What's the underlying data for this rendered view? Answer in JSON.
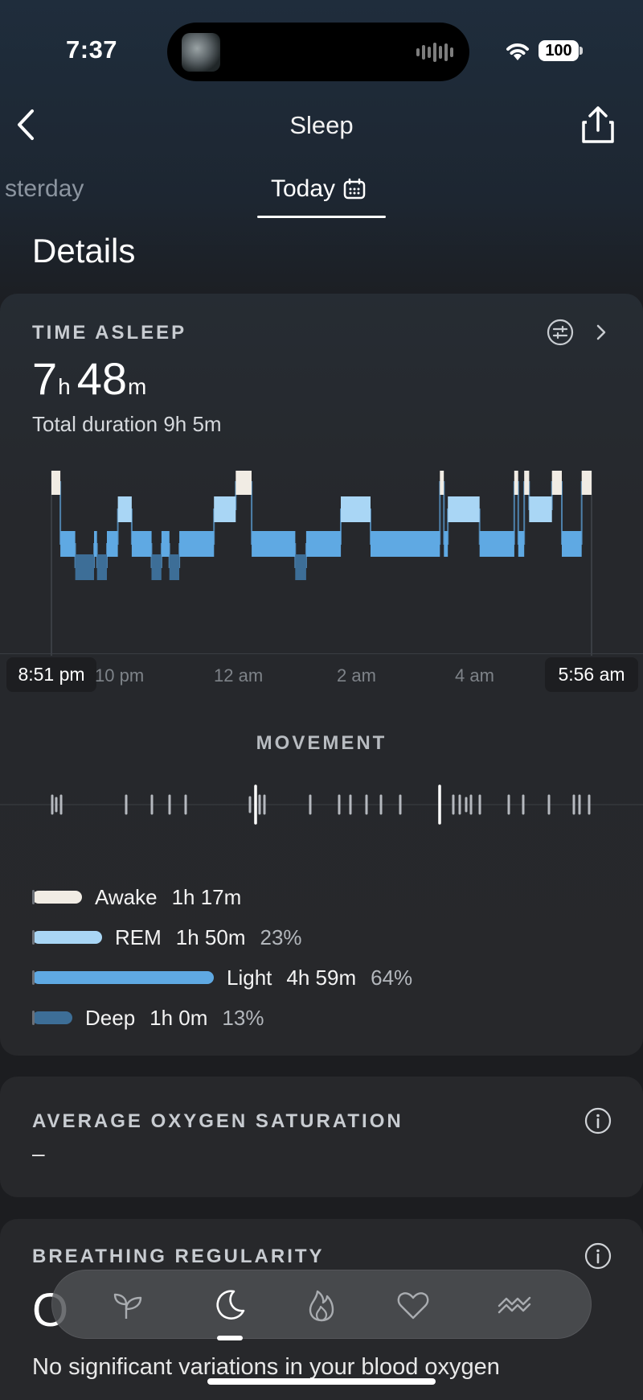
{
  "status_bar": {
    "time": "7:37",
    "battery": "100"
  },
  "header": {
    "title": "Sleep"
  },
  "date_tabs": {
    "previous": "sterday",
    "current": "Today"
  },
  "details": {
    "title": "Details",
    "time_asleep": {
      "label": "TIME ASLEEP",
      "hours": "7",
      "hours_unit": "h",
      "minutes": "48",
      "minutes_unit": "m",
      "total_duration": "Total duration 9h 5m"
    },
    "chart": {
      "start_time": "8:51 pm",
      "end_time": "5:56 am",
      "tick_labels": [
        "10 pm",
        "12 am",
        "2 am",
        "4 am"
      ]
    },
    "movement": {
      "label": "MOVEMENT"
    },
    "legend": [
      {
        "name": "Awake",
        "duration": "1h 17m",
        "percent": "",
        "color": "#f1ece4"
      },
      {
        "name": "REM",
        "duration": "1h 50m",
        "percent": "23%",
        "color": "#a9d6f5"
      },
      {
        "name": "Light",
        "duration": "4h 59m",
        "percent": "64%",
        "color": "#5fa9e3"
      },
      {
        "name": "Deep",
        "duration": "1h 0m",
        "percent": "13%",
        "color": "#3d6e97"
      }
    ]
  },
  "oxygen": {
    "label": "AVERAGE OXYGEN SATURATION",
    "value": "–"
  },
  "breathing": {
    "label": "BREATHING REGULARITY",
    "value": "O",
    "description": "No significant variations in your blood oxygen"
  },
  "tabbar": {
    "items": [
      {
        "icon": "sprout-icon"
      },
      {
        "icon": "moon-icon",
        "active": true
      },
      {
        "icon": "flame-icon"
      },
      {
        "icon": "heart-icon"
      },
      {
        "icon": "waves-icon"
      }
    ]
  },
  "colors": {
    "awake": "#f1ece4",
    "rem": "#a9d6f5",
    "light": "#5fa9e3",
    "deep": "#3d6e97"
  },
  "chart_data": {
    "type": "area",
    "title": "",
    "x_range": [
      "8:51 pm",
      "5:56 am"
    ],
    "x_ticks": [
      "10 pm",
      "12 am",
      "2 am",
      "4 am"
    ],
    "stages": [
      "Awake",
      "REM",
      "Light",
      "Deep"
    ],
    "segments": [
      {
        "stage": "Awake",
        "start": "8:51 pm",
        "end": "9:00 pm"
      },
      {
        "stage": "Light",
        "start": "9:00 pm",
        "end": "9:15 pm"
      },
      {
        "stage": "Deep",
        "start": "9:15 pm",
        "end": "9:34 pm"
      },
      {
        "stage": "Light",
        "start": "9:34 pm",
        "end": "9:37 pm"
      },
      {
        "stage": "Deep",
        "start": "9:37 pm",
        "end": "9:47 pm"
      },
      {
        "stage": "Light",
        "start": "9:47 pm",
        "end": "9:58 pm"
      },
      {
        "stage": "REM",
        "start": "9:58 pm",
        "end": "10:12 pm"
      },
      {
        "stage": "Light",
        "start": "10:12 pm",
        "end": "10:32 pm"
      },
      {
        "stage": "Deep",
        "start": "10:32 pm",
        "end": "10:42 pm"
      },
      {
        "stage": "Light",
        "start": "10:42 pm",
        "end": "10:50 pm"
      },
      {
        "stage": "Deep",
        "start": "10:50 pm",
        "end": "11:00 pm"
      },
      {
        "stage": "Light",
        "start": "11:00 pm",
        "end": "11:35 pm"
      },
      {
        "stage": "REM",
        "start": "11:35 pm",
        "end": "11:57 pm"
      },
      {
        "stage": "Awake",
        "start": "11:57 pm",
        "end": "12:13 am"
      },
      {
        "stage": "Light",
        "start": "12:13 am",
        "end": "12:57 am"
      },
      {
        "stage": "Deep",
        "start": "12:57 am",
        "end": "1:08 am"
      },
      {
        "stage": "Light",
        "start": "1:08 am",
        "end": "1:43 am"
      },
      {
        "stage": "REM",
        "start": "1:43 am",
        "end": "2:13 am"
      },
      {
        "stage": "Light",
        "start": "2:13 am",
        "end": "3:23 am"
      },
      {
        "stage": "Awake",
        "start": "3:23 am",
        "end": "3:27 am"
      },
      {
        "stage": "Light",
        "start": "3:27 am",
        "end": "3:31 am"
      },
      {
        "stage": "REM",
        "start": "3:31 am",
        "end": "4:03 am"
      },
      {
        "stage": "Light",
        "start": "4:03 am",
        "end": "4:38 am"
      },
      {
        "stage": "Awake",
        "start": "4:38 am",
        "end": "4:42 am"
      },
      {
        "stage": "Light",
        "start": "4:42 am",
        "end": "4:48 am"
      },
      {
        "stage": "Awake",
        "start": "4:48 am",
        "end": "4:53 am"
      },
      {
        "stage": "REM",
        "start": "4:53 am",
        "end": "5:16 am"
      },
      {
        "stage": "Awake",
        "start": "5:16 am",
        "end": "5:26 am"
      },
      {
        "stage": "Light",
        "start": "5:26 am",
        "end": "5:46 am"
      },
      {
        "stage": "Awake",
        "start": "5:46 am",
        "end": "5:56 am"
      }
    ],
    "legend": [
      {
        "name": "Awake",
        "duration": "1h 17m",
        "percent": ""
      },
      {
        "name": "REM",
        "duration": "1h 50m",
        "percent": "23%"
      },
      {
        "name": "Light",
        "duration": "4h 59m",
        "percent": "64%"
      },
      {
        "name": "Deep",
        "duration": "1h 0m",
        "percent": "13%"
      }
    ]
  }
}
